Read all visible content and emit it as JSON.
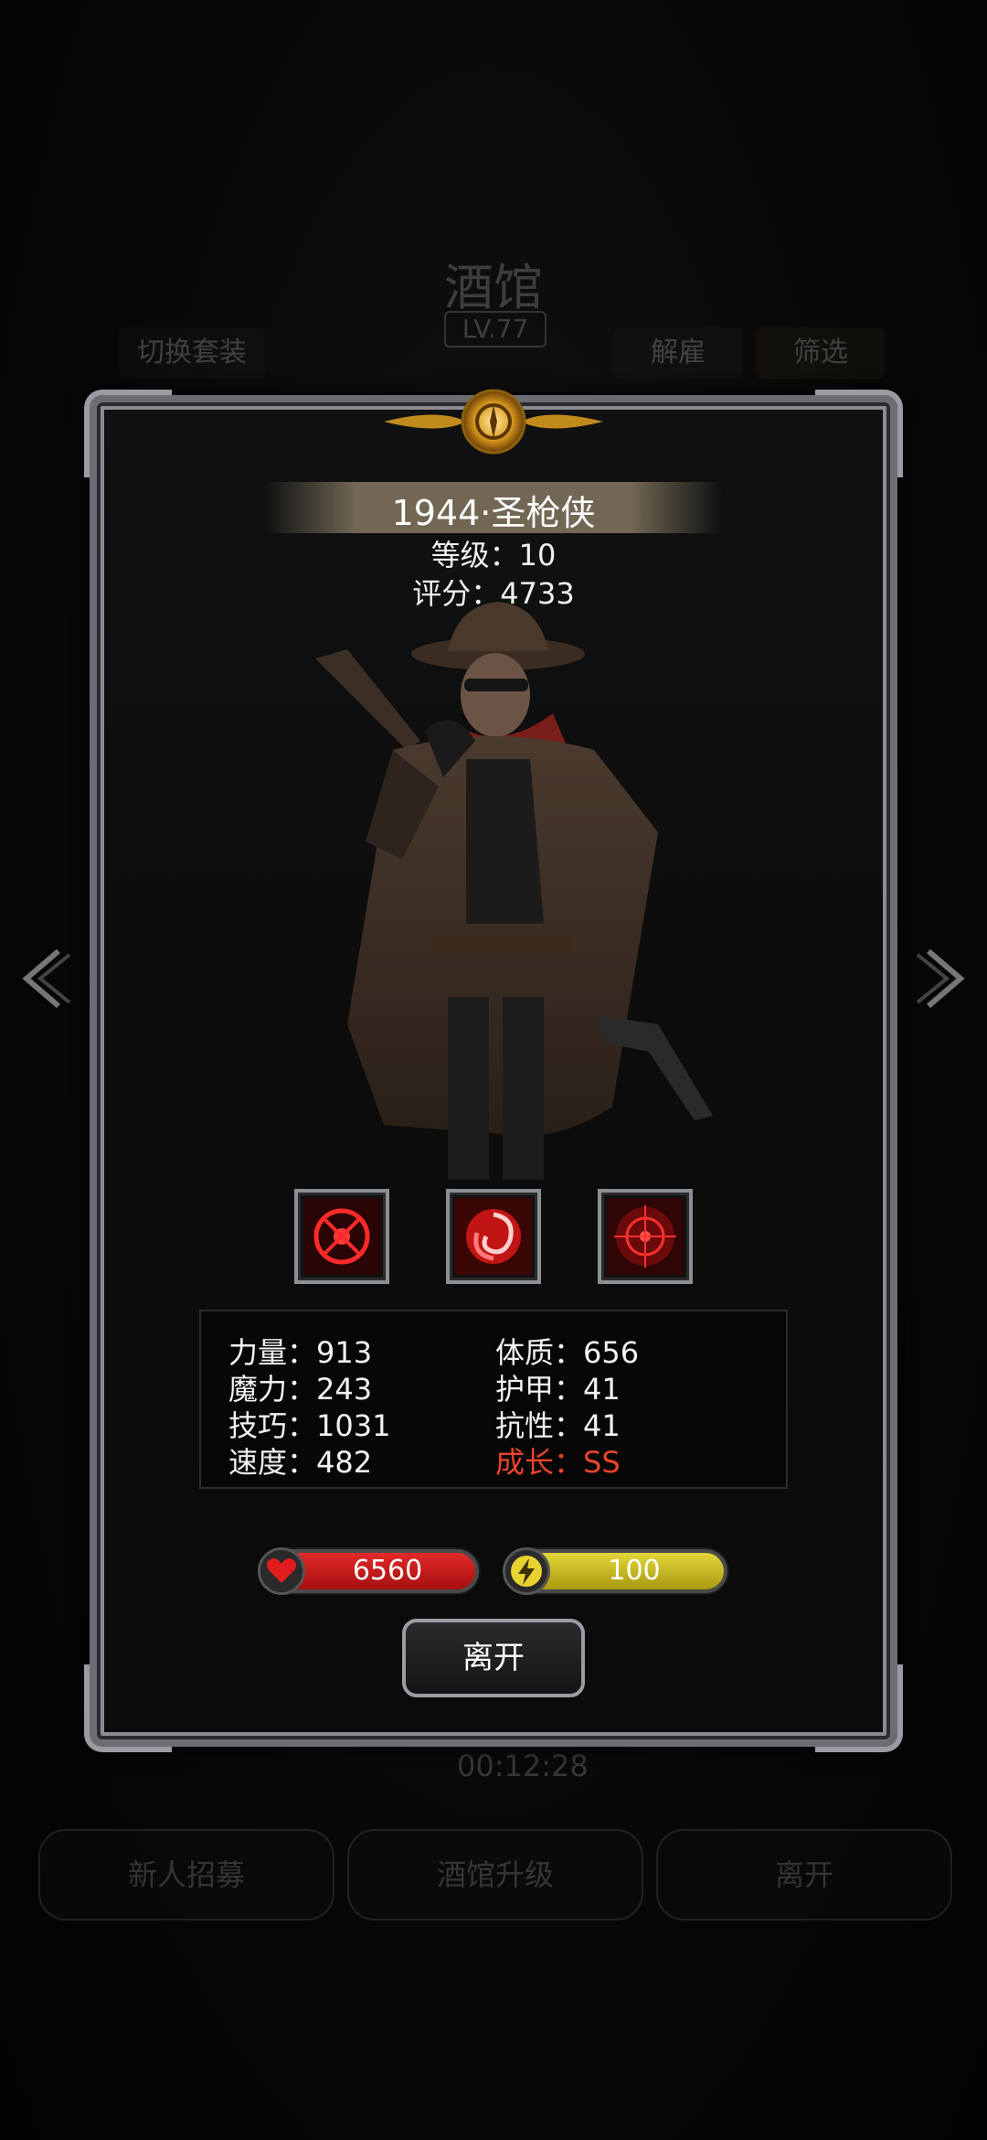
{
  "background": {
    "title": "酒馆",
    "level": "LV.77",
    "switch_outfit": "切换套装",
    "dismiss": "解雇",
    "filter": "筛选",
    "timer": "00:12:28",
    "bottom_buttons": [
      "新人招募",
      "酒馆升级",
      "离开"
    ]
  },
  "hero": {
    "name": "1944·圣枪侠",
    "level_text": "等级：10",
    "score_text": "评分：4733"
  },
  "skills": [
    {
      "icon": "crosshair-skill-icon"
    },
    {
      "icon": "vortex-skill-icon"
    },
    {
      "icon": "target-skill-icon"
    }
  ],
  "stats": {
    "left": [
      {
        "text": "力量：913"
      },
      {
        "text": "魔力：243"
      },
      {
        "text": "技巧：1031"
      },
      {
        "text": "速度：482"
      }
    ],
    "right": [
      {
        "text": "体质：656"
      },
      {
        "text": "护甲：41"
      },
      {
        "text": "抗性：41"
      },
      {
        "text": "成长：SS"
      }
    ]
  },
  "bars": {
    "hp": {
      "value": "6560",
      "icon": "heart-icon",
      "color": "#d41f1f"
    },
    "energy": {
      "value": "100",
      "icon": "lightning-icon",
      "color": "#d2c42a"
    }
  },
  "leave_button": "离开",
  "colors": {
    "growth": "#e8442b",
    "frame": "#8a8c91"
  }
}
